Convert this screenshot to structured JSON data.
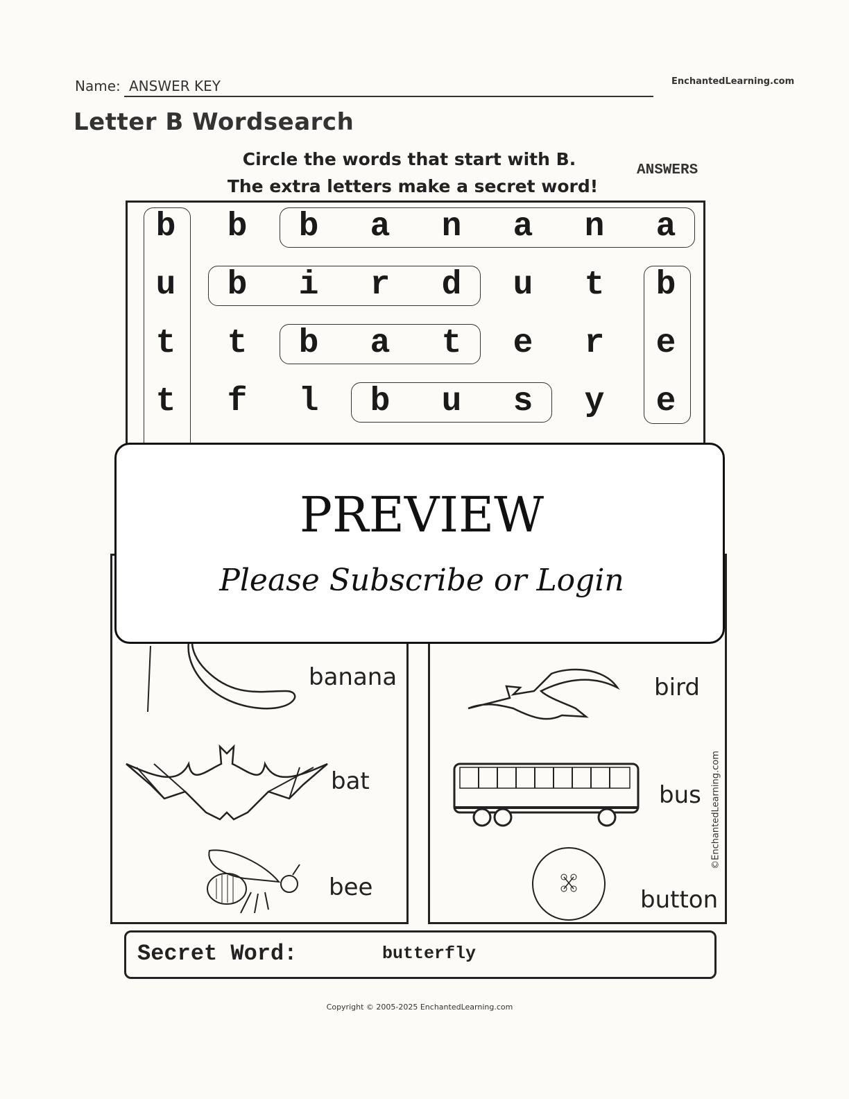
{
  "header": {
    "name_label": "Name:",
    "name_value": "ANSWER KEY",
    "brand": "EnchantedLearning.com",
    "title": "Letter B Wordsearch"
  },
  "instructions": {
    "line1": "Circle the words that start with B.",
    "line2": "The extra letters make a secret word!",
    "answers_label": "ANSWERS"
  },
  "grid": {
    "rows": [
      [
        "b",
        "b",
        "b",
        "a",
        "n",
        "a",
        "n",
        "a"
      ],
      [
        "u",
        "b",
        "i",
        "r",
        "d",
        "u",
        "t",
        "b"
      ],
      [
        "t",
        "t",
        "b",
        "a",
        "t",
        "e",
        "r",
        "e"
      ],
      [
        "t",
        "f",
        "l",
        "b",
        "u",
        "s",
        "y",
        "e"
      ]
    ],
    "circled_words": [
      {
        "word": "button",
        "direction": "vertical",
        "row": 0,
        "col": 0,
        "length": 6
      },
      {
        "word": "banana",
        "direction": "horizontal",
        "row": 0,
        "col": 2,
        "length": 6
      },
      {
        "word": "bird",
        "direction": "horizontal",
        "row": 1,
        "col": 1,
        "length": 4
      },
      {
        "word": "bee",
        "direction": "vertical",
        "row": 1,
        "col": 7,
        "length": 3
      },
      {
        "word": "bat",
        "direction": "horizontal",
        "row": 2,
        "col": 2,
        "length": 3
      },
      {
        "word": "bus",
        "direction": "horizontal",
        "row": 3,
        "col": 3,
        "length": 3
      }
    ]
  },
  "pictures": {
    "left": [
      {
        "label": "banana",
        "icon": "banana-icon"
      },
      {
        "label": "bat",
        "icon": "bat-icon"
      },
      {
        "label": "bee",
        "icon": "bee-icon"
      }
    ],
    "right": [
      {
        "label": "bird",
        "icon": "bird-icon"
      },
      {
        "label": "bus",
        "icon": "bus-icon"
      },
      {
        "label": "button",
        "icon": "button-icon"
      }
    ],
    "credit": "©EnchantedLearning.com"
  },
  "secret": {
    "label": "Secret Word:",
    "value": "butterfly"
  },
  "preview": {
    "title": "PREVIEW",
    "subtitle": "Please Subscribe or Login"
  },
  "footer": {
    "copyright": "Copyright © 2005-2025 EnchantedLearning.com"
  }
}
